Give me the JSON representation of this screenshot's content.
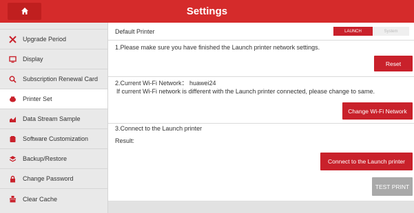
{
  "header": {
    "title": "Settings",
    "home_icon": "home-icon"
  },
  "colors": {
    "accent": "#d52b2b",
    "button": "#c9212b",
    "disabled": "#a9a9a9",
    "sidebar_bg": "#e9e9e9"
  },
  "sidebar": {
    "items": [
      {
        "label": "Upgrade Period",
        "icon": "upgrade-icon"
      },
      {
        "label": "Display",
        "icon": "display-icon"
      },
      {
        "label": "Subscription Renewal Card",
        "icon": "search-icon"
      },
      {
        "label": "Printer Set",
        "icon": "printer-icon"
      },
      {
        "label": "Data Stream Sample",
        "icon": "chart-icon"
      },
      {
        "label": "Software Customization",
        "icon": "software-icon"
      },
      {
        "label": "Backup/Restore",
        "icon": "backup-icon"
      },
      {
        "label": "Change Password",
        "icon": "lock-icon"
      },
      {
        "label": "Clear Cache",
        "icon": "cache-icon"
      }
    ],
    "active_index": 3
  },
  "main": {
    "default_printer_label": "Default Printer",
    "toggle": {
      "on": "LAUNCH",
      "off": "System"
    },
    "step1_text": "1.Please make sure you have finished the Launch printer network settings.",
    "reset_label": "Reset",
    "step2_text": "2.Current Wi-Fi Network： huawei24",
    "step2_note": "If current Wi-Fi network is different with the Launch printer connected, please change to same.",
    "change_wifi_label": "Change Wi-Fi Network",
    "step3_text": "3.Connect to the Launch printer",
    "result_label": "Result:",
    "connect_label": "Connect to the Launch printer",
    "test_print_label": "TEST PRINT"
  }
}
